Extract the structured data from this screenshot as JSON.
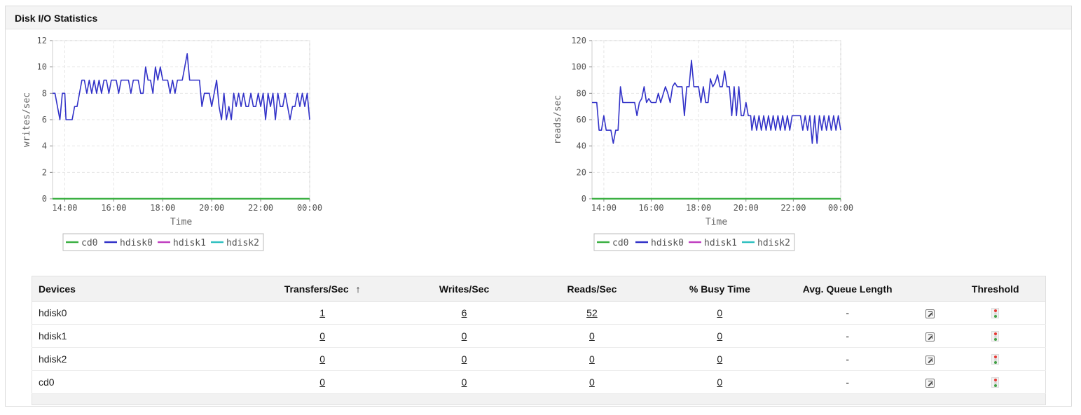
{
  "panel": {
    "title": "Disk I/O Statistics"
  },
  "colors": {
    "cd0": "#3cb043",
    "hdisk0": "#3232c8",
    "hdisk1": "#c040c0",
    "hdisk2": "#30c0c0"
  },
  "chart_data": [
    {
      "type": "line",
      "ylabel": "writes/sec",
      "xlabel": "Time",
      "ylim": [
        0,
        12
      ],
      "yticks": [
        "0",
        "2",
        "4",
        "6",
        "8",
        "10",
        "12"
      ],
      "xticks": [
        "14:00",
        "16:00",
        "18:00",
        "20:00",
        "22:00",
        "00:00"
      ],
      "xlim": [
        13.5,
        24.0
      ],
      "grid": true,
      "legend": "bottom",
      "series": [
        {
          "name": "cd0",
          "color": "#3cb043",
          "values": [
            [
              13.5,
              0
            ],
            [
              24,
              0
            ]
          ]
        },
        {
          "name": "hdisk0",
          "color": "#3232c8",
          "values": [
            [
              13.5,
              8
            ],
            [
              13.6,
              8
            ],
            [
              13.7,
              7
            ],
            [
              13.8,
              6
            ],
            [
              13.9,
              8
            ],
            [
              14.0,
              8
            ],
            [
              14.05,
              6
            ],
            [
              14.3,
              6
            ],
            [
              14.4,
              7
            ],
            [
              14.5,
              7
            ],
            [
              14.7,
              9
            ],
            [
              14.8,
              9
            ],
            [
              14.9,
              8
            ],
            [
              15.0,
              9
            ],
            [
              15.1,
              8
            ],
            [
              15.2,
              9
            ],
            [
              15.3,
              8
            ],
            [
              15.4,
              9
            ],
            [
              15.5,
              8
            ],
            [
              15.6,
              9
            ],
            [
              15.7,
              9
            ],
            [
              15.8,
              8
            ],
            [
              15.9,
              9
            ],
            [
              16.1,
              9
            ],
            [
              16.2,
              8
            ],
            [
              16.3,
              9
            ],
            [
              16.6,
              9
            ],
            [
              16.7,
              8
            ],
            [
              16.8,
              9
            ],
            [
              17.0,
              9
            ],
            [
              17.1,
              8
            ],
            [
              17.2,
              8
            ],
            [
              17.3,
              10
            ],
            [
              17.4,
              9
            ],
            [
              17.5,
              9
            ],
            [
              17.6,
              8
            ],
            [
              17.7,
              10
            ],
            [
              17.8,
              9
            ],
            [
              17.9,
              10
            ],
            [
              18.0,
              9
            ],
            [
              18.2,
              9
            ],
            [
              18.3,
              8
            ],
            [
              18.4,
              9
            ],
            [
              18.5,
              8
            ],
            [
              18.6,
              9
            ],
            [
              18.8,
              9
            ],
            [
              18.9,
              10
            ],
            [
              19.0,
              11
            ],
            [
              19.1,
              9
            ],
            [
              19.5,
              9
            ],
            [
              19.6,
              7
            ],
            [
              19.7,
              8
            ],
            [
              19.9,
              8
            ],
            [
              20.0,
              7
            ],
            [
              20.1,
              8
            ],
            [
              20.2,
              9
            ],
            [
              20.3,
              7
            ],
            [
              20.4,
              6
            ],
            [
              20.5,
              8
            ],
            [
              20.6,
              6
            ],
            [
              20.7,
              7
            ],
            [
              20.8,
              6
            ],
            [
              20.9,
              8
            ],
            [
              21.0,
              7
            ],
            [
              21.1,
              8
            ],
            [
              21.2,
              7
            ],
            [
              21.3,
              8
            ],
            [
              21.4,
              7
            ],
            [
              21.5,
              7
            ],
            [
              21.6,
              8
            ],
            [
              21.7,
              7
            ],
            [
              21.8,
              7
            ],
            [
              21.9,
              8
            ],
            [
              22.0,
              7
            ],
            [
              22.1,
              8
            ],
            [
              22.2,
              6
            ],
            [
              22.3,
              8
            ],
            [
              22.4,
              7
            ],
            [
              22.5,
              8
            ],
            [
              22.6,
              6
            ],
            [
              22.7,
              8
            ],
            [
              22.8,
              7
            ],
            [
              22.9,
              7
            ],
            [
              23.0,
              8
            ],
            [
              23.1,
              7
            ],
            [
              23.2,
              6
            ],
            [
              23.3,
              7
            ],
            [
              23.4,
              7
            ],
            [
              23.5,
              8
            ],
            [
              23.6,
              7
            ],
            [
              23.7,
              8
            ],
            [
              23.8,
              7
            ],
            [
              23.9,
              8
            ],
            [
              24.0,
              6
            ]
          ]
        },
        {
          "name": "hdisk1",
          "color": "#c040c0",
          "values": []
        },
        {
          "name": "hdisk2",
          "color": "#30c0c0",
          "values": []
        }
      ]
    },
    {
      "type": "line",
      "ylabel": "reads/sec",
      "xlabel": "Time",
      "ylim": [
        0,
        120
      ],
      "yticks": [
        "0",
        "20",
        "40",
        "60",
        "80",
        "100",
        "120"
      ],
      "xticks": [
        "14:00",
        "16:00",
        "18:00",
        "20:00",
        "22:00",
        "00:00"
      ],
      "xlim": [
        13.5,
        24.0
      ],
      "grid": true,
      "legend": "bottom",
      "series": [
        {
          "name": "cd0",
          "color": "#3cb043",
          "values": [
            [
              13.5,
              0
            ],
            [
              24,
              0
            ]
          ]
        },
        {
          "name": "hdisk0",
          "color": "#3232c8",
          "values": [
            [
              13.5,
              73
            ],
            [
              13.7,
              73
            ],
            [
              13.8,
              52
            ],
            [
              13.9,
              52
            ],
            [
              14.0,
              63
            ],
            [
              14.1,
              52
            ],
            [
              14.3,
              52
            ],
            [
              14.4,
              42
            ],
            [
              14.5,
              52
            ],
            [
              14.6,
              52
            ],
            [
              14.7,
              85
            ],
            [
              14.8,
              73
            ],
            [
              15.0,
              73
            ],
            [
              15.1,
              73
            ],
            [
              15.3,
              73
            ],
            [
              15.4,
              63
            ],
            [
              15.5,
              73
            ],
            [
              15.6,
              76
            ],
            [
              15.7,
              85
            ],
            [
              15.8,
              73
            ],
            [
              15.9,
              76
            ],
            [
              16.0,
              73
            ],
            [
              16.2,
              73
            ],
            [
              16.3,
              80
            ],
            [
              16.4,
              73
            ],
            [
              16.6,
              85
            ],
            [
              16.7,
              80
            ],
            [
              16.8,
              73
            ],
            [
              16.9,
              85
            ],
            [
              17.0,
              88
            ],
            [
              17.1,
              85
            ],
            [
              17.3,
              85
            ],
            [
              17.4,
              63
            ],
            [
              17.5,
              85
            ],
            [
              17.6,
              85
            ],
            [
              17.7,
              105
            ],
            [
              17.8,
              85
            ],
            [
              18.0,
              85
            ],
            [
              18.1,
              73
            ],
            [
              18.2,
              85
            ],
            [
              18.3,
              73
            ],
            [
              18.4,
              73
            ],
            [
              18.5,
              91
            ],
            [
              18.6,
              85
            ],
            [
              18.7,
              88
            ],
            [
              18.8,
              94
            ],
            [
              18.9,
              85
            ],
            [
              19.0,
              85
            ],
            [
              19.1,
              97
            ],
            [
              19.2,
              85
            ],
            [
              19.3,
              85
            ],
            [
              19.4,
              63
            ],
            [
              19.5,
              85
            ],
            [
              19.6,
              63
            ],
            [
              19.7,
              85
            ],
            [
              19.8,
              63
            ],
            [
              19.9,
              63
            ],
            [
              20.0,
              73
            ],
            [
              20.1,
              63
            ],
            [
              20.2,
              63
            ],
            [
              20.25,
              52
            ],
            [
              20.35,
              63
            ],
            [
              20.45,
              52
            ],
            [
              20.55,
              63
            ],
            [
              20.65,
              52
            ],
            [
              20.75,
              63
            ],
            [
              20.85,
              52
            ],
            [
              20.95,
              63
            ],
            [
              21.05,
              52
            ],
            [
              21.15,
              63
            ],
            [
              21.25,
              52
            ],
            [
              21.35,
              63
            ],
            [
              21.45,
              52
            ],
            [
              21.55,
              63
            ],
            [
              21.65,
              52
            ],
            [
              21.75,
              63
            ],
            [
              21.85,
              52
            ],
            [
              21.95,
              63
            ],
            [
              22.1,
              63
            ],
            [
              22.3,
              63
            ],
            [
              22.4,
              52
            ],
            [
              22.5,
              63
            ],
            [
              22.6,
              52
            ],
            [
              22.7,
              63
            ],
            [
              22.8,
              42
            ],
            [
              22.9,
              63
            ],
            [
              23.0,
              42
            ],
            [
              23.1,
              63
            ],
            [
              23.2,
              52
            ],
            [
              23.3,
              63
            ],
            [
              23.4,
              52
            ],
            [
              23.5,
              63
            ],
            [
              23.6,
              52
            ],
            [
              23.7,
              63
            ],
            [
              23.8,
              52
            ],
            [
              23.9,
              63
            ],
            [
              24.0,
              52
            ]
          ]
        },
        {
          "name": "hdisk1",
          "color": "#c040c0",
          "values": []
        },
        {
          "name": "hdisk2",
          "color": "#30c0c0",
          "values": []
        }
      ]
    }
  ],
  "table": {
    "headers": {
      "devices": "Devices",
      "transfers": "Transfers/Sec",
      "sort_arrow": "↑",
      "writes": "Writes/Sec",
      "reads": "Reads/Sec",
      "busy": "% Busy Time",
      "queue": "Avg. Queue Length",
      "threshold": "Threshold"
    },
    "rows": [
      {
        "device": "hdisk0",
        "transfers": "1",
        "writes": "6",
        "reads": "52",
        "busy": "0",
        "queue": "-",
        "action_icon": "external-link-icon",
        "threshold_icon": "traffic-light-icon"
      },
      {
        "device": "hdisk1",
        "transfers": "0",
        "writes": "0",
        "reads": "0",
        "busy": "0",
        "queue": "-",
        "action_icon": "external-link-icon",
        "threshold_icon": "traffic-light-icon"
      },
      {
        "device": "hdisk2",
        "transfers": "0",
        "writes": "0",
        "reads": "0",
        "busy": "0",
        "queue": "-",
        "action_icon": "external-link-icon",
        "threshold_icon": "traffic-light-icon"
      },
      {
        "device": "cd0",
        "transfers": "0",
        "writes": "0",
        "reads": "0",
        "busy": "0",
        "queue": "-",
        "action_icon": "external-link-icon",
        "threshold_icon": "traffic-light-icon"
      }
    ]
  }
}
